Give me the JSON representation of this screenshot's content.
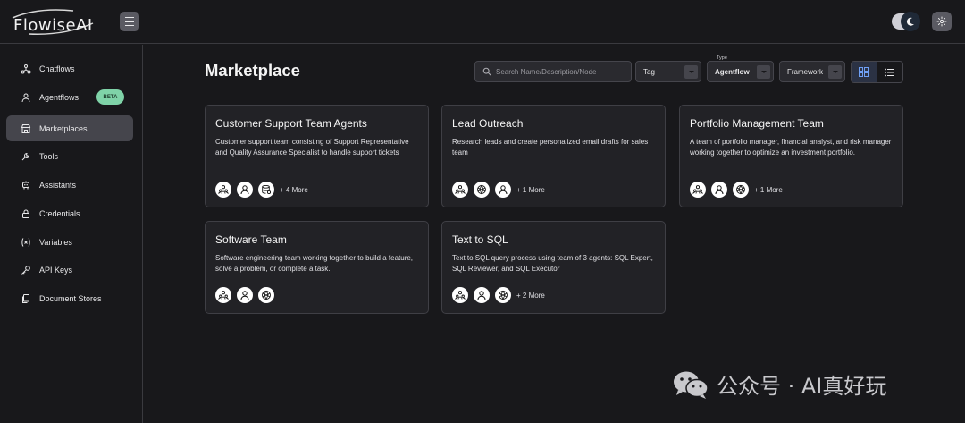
{
  "app": {
    "logo_text": "FlowiseAI"
  },
  "sidebar": {
    "items": [
      {
        "label": "Chatflows",
        "icon": "chatflows-icon"
      },
      {
        "label": "Agentflows",
        "icon": "agentflows-icon",
        "badge": "BETA"
      },
      {
        "label": "Marketplaces",
        "icon": "marketplace-icon",
        "active": true
      },
      {
        "label": "Tools",
        "icon": "tools-icon"
      },
      {
        "label": "Assistants",
        "icon": "assistants-icon"
      },
      {
        "label": "Credentials",
        "icon": "lock-icon"
      },
      {
        "label": "Variables",
        "icon": "variable-icon"
      },
      {
        "label": "API Keys",
        "icon": "key-icon"
      },
      {
        "label": "Document Stores",
        "icon": "document-stores-icon"
      }
    ]
  },
  "main": {
    "title": "Marketplace",
    "search_placeholder": "Search Name/Description/Node",
    "filters": {
      "tag_value": "Tag",
      "type_label": "Type",
      "type_value": "Agentflow",
      "framework_value": "Framework"
    },
    "view": {
      "active": "grid"
    }
  },
  "cards": [
    {
      "title": "Customer Support Team Agents",
      "description": "Customer support team consisting of Support Representative and Quality Assurance Specialist to handle support tickets",
      "icons": [
        "supervisor-icon",
        "worker-icon",
        "database-icon"
      ],
      "more": "+ 4 More"
    },
    {
      "title": "Lead Outreach",
      "description": "Research leads and create personalized email drafts for sales team",
      "icons": [
        "supervisor-icon",
        "openai-icon",
        "worker-icon"
      ],
      "more": "+ 1 More"
    },
    {
      "title": "Portfolio Management Team",
      "description": "A team of portfolio manager, financial analyst, and risk manager working together to optimize an investment portfolio.",
      "icons": [
        "supervisor-icon",
        "worker-icon",
        "openai-icon"
      ],
      "more": "+ 1 More"
    },
    {
      "title": "Software Team",
      "description": "Software engineering team working together to build a feature, solve a problem, or complete a task.",
      "icons": [
        "supervisor-icon",
        "worker-icon",
        "openai-icon"
      ],
      "more": ""
    },
    {
      "title": "Text to SQL",
      "description": "Text to SQL query process using team of 3 agents: SQL Expert, SQL Reviewer, and SQL Executor",
      "icons": [
        "supervisor-icon",
        "worker-icon",
        "openai-icon"
      ],
      "more": "+ 2 More"
    }
  ],
  "watermark": {
    "text": "公众号 · AI真好玩"
  }
}
